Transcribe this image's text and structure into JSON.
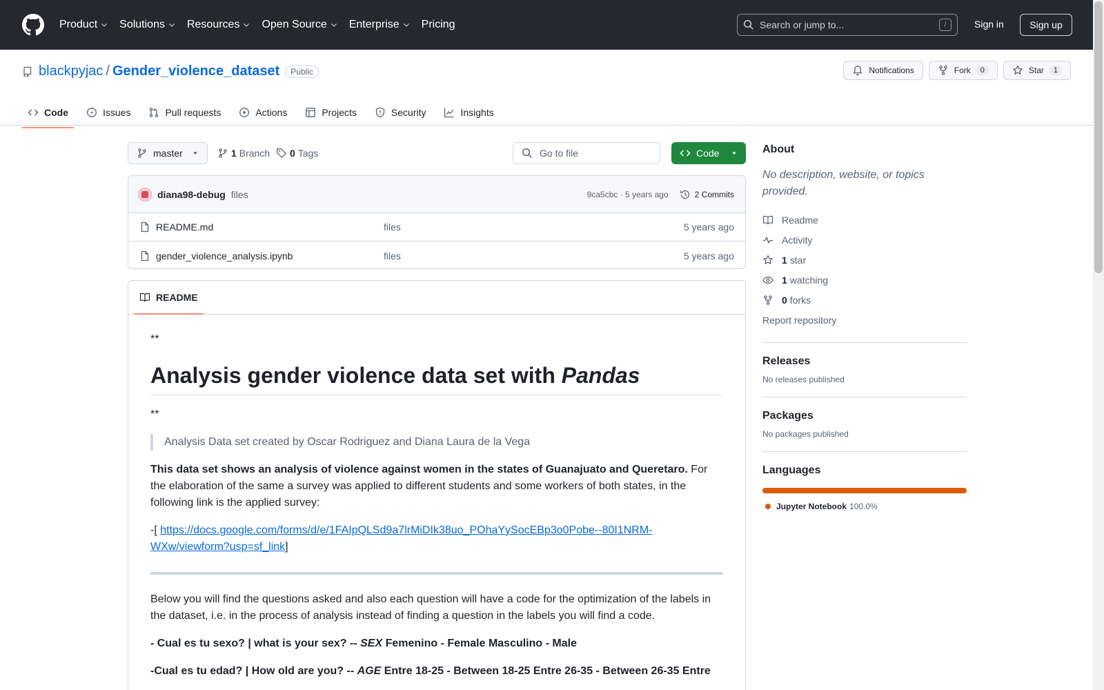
{
  "header": {
    "nav": [
      "Product",
      "Solutions",
      "Resources",
      "Open Source",
      "Enterprise",
      "Pricing"
    ],
    "search_placeholder": "Search or jump to...",
    "search_kbd": "/",
    "sign_in": "Sign in",
    "sign_up": "Sign up"
  },
  "repo": {
    "owner": "blackpyjac",
    "name": "Gender_violence_dataset",
    "visibility": "Public",
    "notifications_label": "Notifications",
    "fork_label": "Fork",
    "fork_count": "0",
    "star_label": "Star",
    "star_count": "1",
    "tabs": [
      "Code",
      "Issues",
      "Pull requests",
      "Actions",
      "Projects",
      "Security",
      "Insights"
    ]
  },
  "toolbar": {
    "branch": "master",
    "branch_count": "1",
    "branch_label": "Branch",
    "tag_count": "0",
    "tag_label": "Tags",
    "goto_placeholder": "Go to file",
    "code_label": "Code"
  },
  "commit": {
    "author": "diana98-debug",
    "message": "files",
    "meta": "9ca5cbc · 5 years ago",
    "commits_label": "2 Commits"
  },
  "files": [
    {
      "name": "README.md",
      "message": "files",
      "date": "5 years ago"
    },
    {
      "name": "gender_violence_analysis.ipynb",
      "message": "files",
      "date": "5 years ago"
    }
  ],
  "readme": {
    "tab_label": "README",
    "stars1": "**",
    "title_plain": "Analysis gender violence data set with ",
    "title_em": "Pandas",
    "stars2": "**",
    "quote": "Analysis Data set created by Oscar Rodriguez and Diana Laura de la Vega",
    "p1_bold": "This data set shows an analysis of violence against women in the states of Guanajuato and Queretaro.",
    "p1_rest": " For the elaboration of the same a survey was applied to different students and some workers of both states, in the following link is the applied survey:",
    "link_prefix": "-[ ",
    "link": "https://docs.google.com/forms/d/e/1FAIpQLSd9a7lrMiDIk38uo_POhaYySocEBp3o0Pobe--80I1NRM-WXw/viewform?usp=sf_link",
    "link_suffix": "]",
    "p2": "Below you will find the questions asked and also each question will have a code for the optimization of the labels in the dataset, i.e. in the process of analysis instead of finding a question in the labels you will find a code.",
    "q1_a": "- Cual es tu sexo? | what is your sex? -- ",
    "q1_em": "SEX",
    "q1_b": " Femenino - Female Masculino - Male",
    "q2_a": "-Cual es tu edad? | How old are you? -- ",
    "q2_em": "AGE",
    "q2_b": " Entre 18-25 - Between 18-25 Entre 26-35 - Between 26-35 Entre"
  },
  "sidebar": {
    "about_title": "About",
    "description": "No description, website, or topics provided.",
    "readme": "Readme",
    "activity": "Activity",
    "stars_count": "1",
    "stars_label": "star",
    "watching_count": "1",
    "watching_label": "watching",
    "forks_count": "0",
    "forks_label": "forks",
    "report": "Report repository",
    "releases_title": "Releases",
    "releases_empty": "No releases published",
    "packages_title": "Packages",
    "packages_empty": "No packages published",
    "languages_title": "Languages",
    "language_name": "Jupyter Notebook",
    "language_pct": "100.0%"
  },
  "colors": {
    "header_bg": "#24292f",
    "link": "#0969da",
    "code_button": "#1f883d",
    "active_tab": "#fd8c73",
    "jupyter": "#da5b0b"
  }
}
